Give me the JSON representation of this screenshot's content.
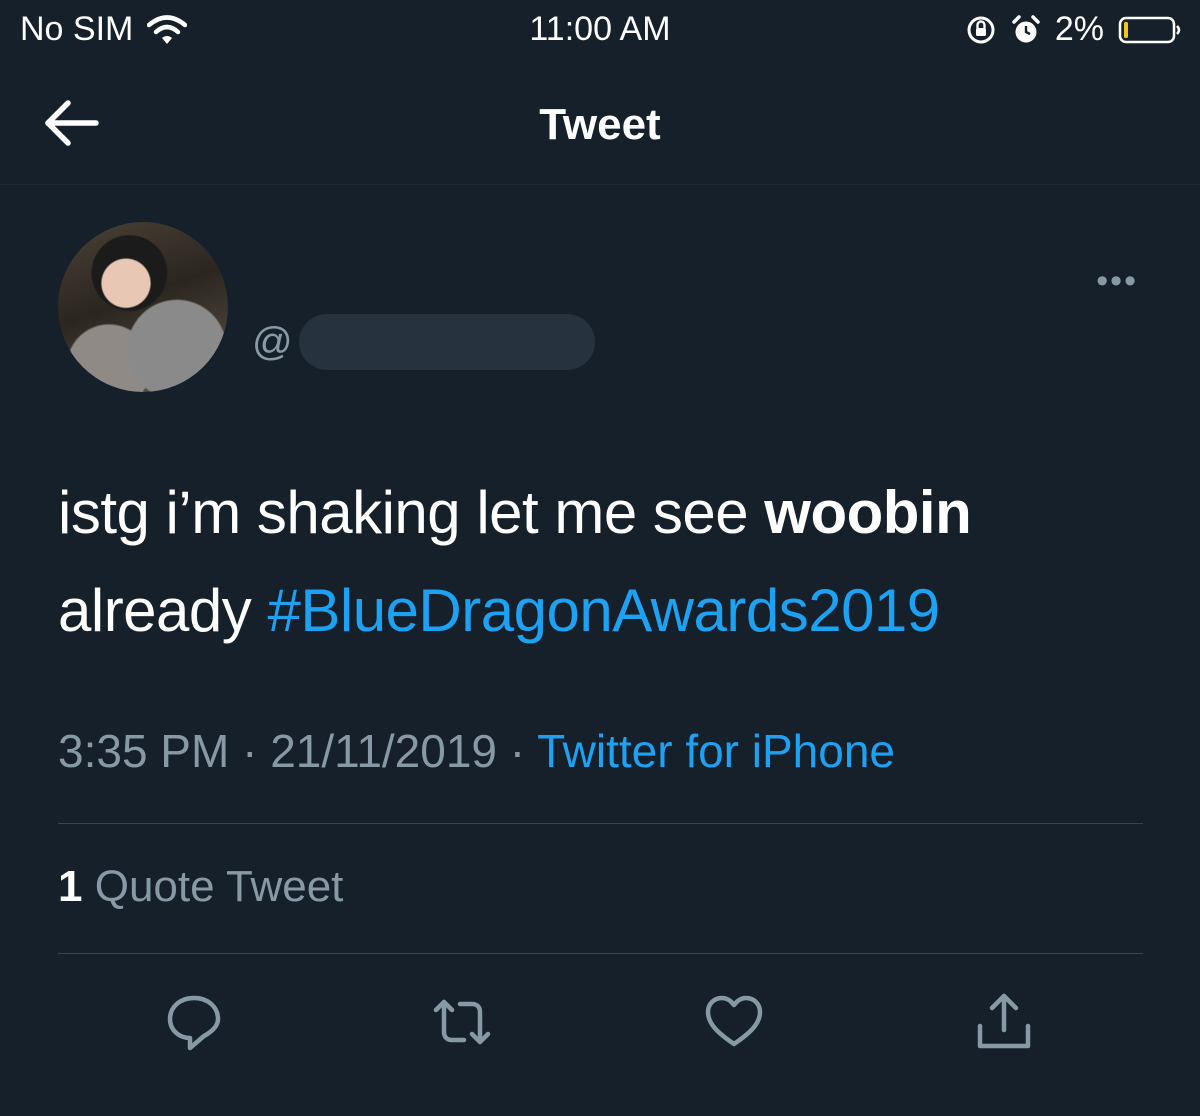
{
  "status_bar": {
    "carrier": "No SIM",
    "time": "11:00 AM",
    "battery_percent": "2%",
    "battery_level": 0.02
  },
  "nav": {
    "title": "Tweet"
  },
  "tweet": {
    "handle_prefix": "@",
    "more_label": "•••",
    "text_before_bold": "istg i’m shaking let me see ",
    "text_bold": "woobin",
    "text_after_bold": " already ",
    "hashtag": "#BlueDragonAwards2019",
    "time": "3:35 PM",
    "date": "21/11/2019",
    "separator": "·",
    "source": "Twitter for iPhone",
    "quote_count": "1",
    "quote_label": "Quote Tweet"
  },
  "icons": {
    "back": "arrow-left-icon",
    "reply": "reply-icon",
    "retweet": "retweet-icon",
    "like": "heart-icon",
    "share": "share-icon"
  },
  "colors": {
    "background": "#15202b",
    "accent": "#1da1f2",
    "secondary_text": "#8899a6",
    "divider": "#38444d",
    "battery_low": "#f5c518"
  }
}
